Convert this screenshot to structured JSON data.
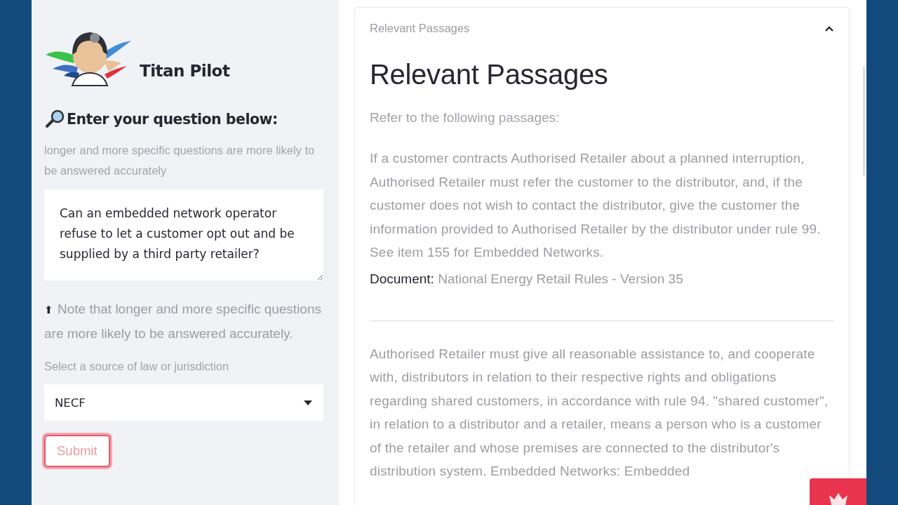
{
  "sidebar": {
    "app_title": "Titan Pilot",
    "heading": "Enter your question below:",
    "hint": "longer and more specific questions are more likely to be answered accurately",
    "question": {
      "value": "Can an embedded network operator refuse to let a customer opt out and be supplied by a third party retailer?"
    },
    "note_icon": "⬆",
    "note": "Note that longer and more specific questions are more likely to be answered accurately.",
    "source_label": "Select a source of law or jurisdiction",
    "source_select": {
      "value": "NECF"
    },
    "submit_button": {
      "label": "Submit",
      "focused": true
    }
  },
  "expander": {
    "label": "Relevant Passages",
    "expanded": true,
    "title": "Relevant Passages",
    "intro": "Refer to the following passages:",
    "passages": [
      {
        "text": "If a customer contracts Authorised Retailer about a planned interruption, Authorised Retailer must refer the customer to the distributor, and, if the customer does not wish to contact the distributor, give the customer the information provided to Authorised Retailer by the distributor under rule 99. See item 155 for Embedded Networks.",
        "document_label": "Document:",
        "document": "National Energy Retail Rules - Version 35"
      },
      {
        "text": "Authorised Retailer must give all reasonable assistance to, and cooperate with, distributors in relation to their respective rights and obligations regarding shared customers, in accordance with rule 94. \"shared customer\", in relation to a distributor and a retailer, means a person who is a customer of the retailer and whose premises are connected to the distributor's distribution system. Embedded Networks: Embedded"
      }
    ]
  }
}
